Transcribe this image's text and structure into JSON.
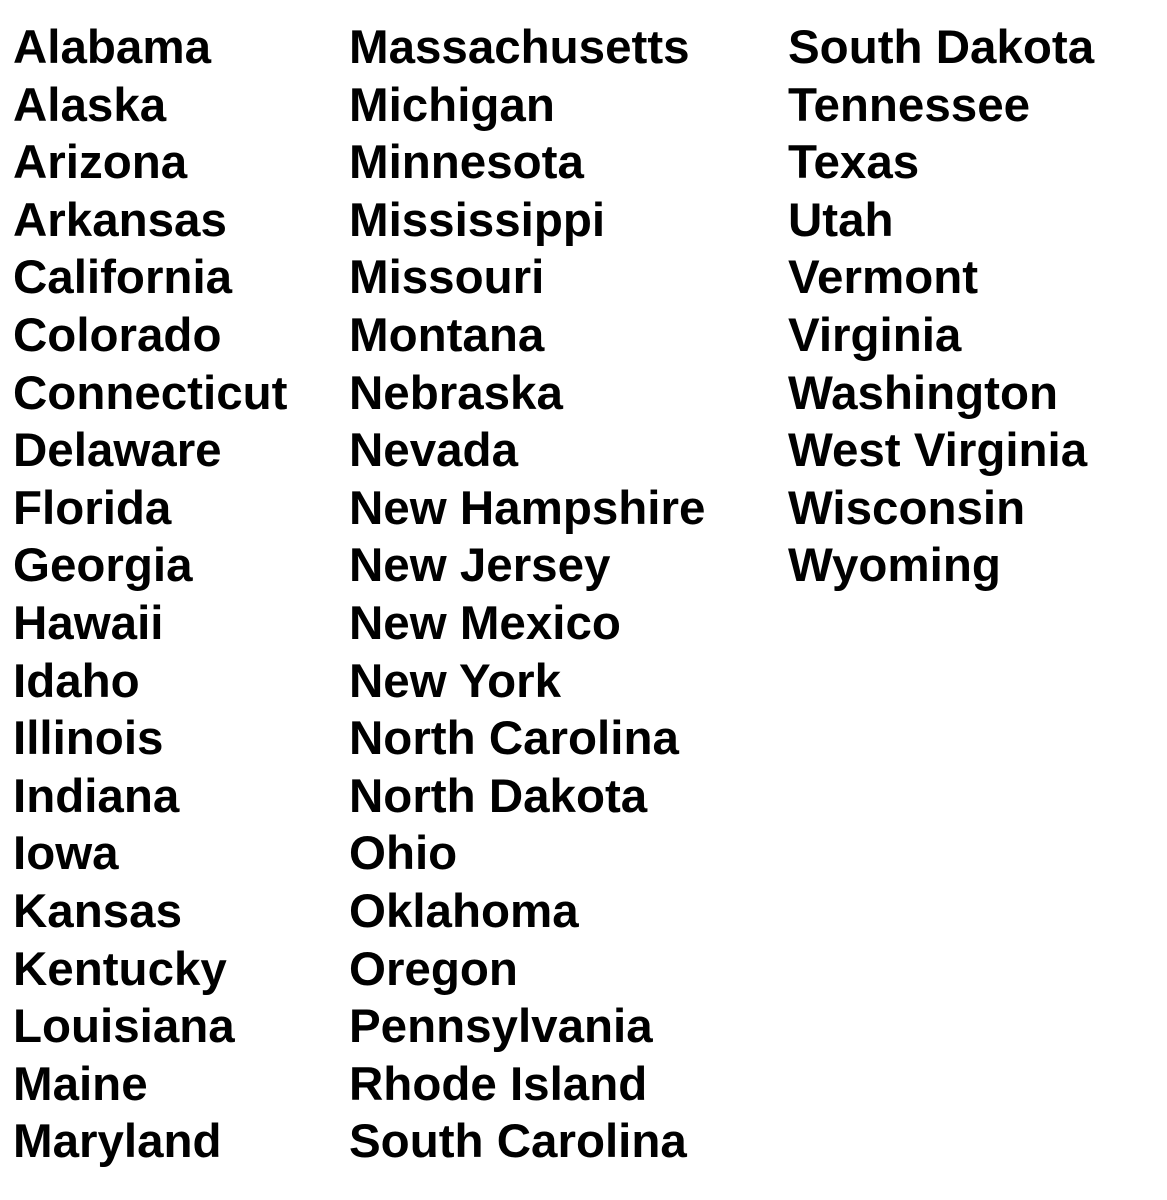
{
  "columns": [
    [
      "Alabama",
      "Alaska",
      "Arizona",
      "Arkansas",
      "California",
      "Colorado",
      "Connecticut",
      "Delaware",
      "Florida",
      "Georgia",
      "Hawaii",
      "Idaho",
      "Illinois",
      "Indiana",
      "Iowa",
      "Kansas",
      "Kentucky",
      "Louisiana",
      "Maine",
      "Maryland"
    ],
    [
      "Massachusetts",
      "Michigan",
      "Minnesota",
      "Mississippi",
      "Missouri",
      "Montana",
      "Nebraska",
      "Nevada",
      "New Hampshire",
      "New Jersey",
      "New Mexico",
      "New York",
      "North Carolina",
      "North Dakota",
      "Ohio",
      "Oklahoma",
      "Oregon",
      "Pennsylvania",
      "Rhode Island",
      "South Carolina"
    ],
    [
      "South Dakota",
      "Tennessee",
      "Texas",
      "Utah",
      "Vermont",
      "Virginia",
      "Washington",
      "West Virginia",
      "Wisconsin",
      "Wyoming"
    ]
  ]
}
